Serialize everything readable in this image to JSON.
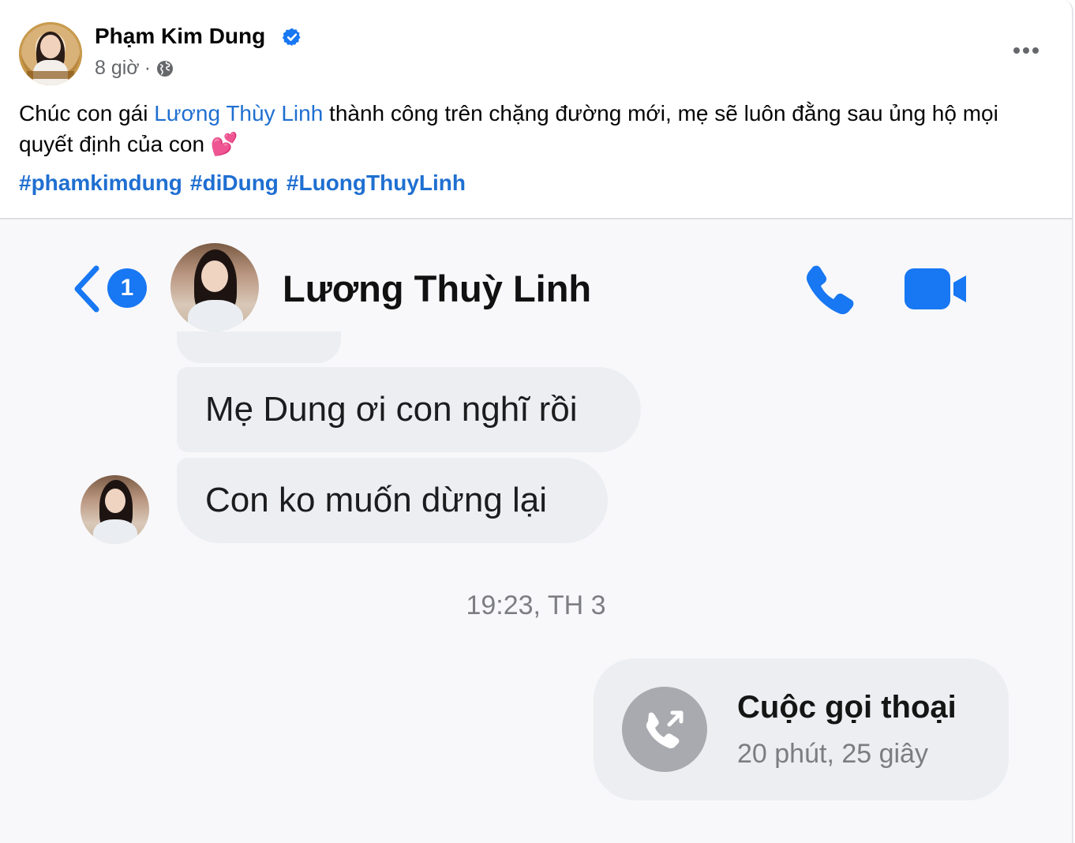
{
  "post": {
    "author": "Phạm Kim Dung",
    "time": "8 giờ",
    "separator": "·",
    "caption": {
      "before": "Chúc con gái ",
      "mention": "Lương Thùy Linh",
      "after": " thành công trên chặng đường mới, mẹ sẽ luôn đằng sau ủng hộ mọi quyết định của con 💕"
    },
    "hashtags": [
      "#phamkimdung",
      "#diDung",
      "#LuongThuyLinh"
    ]
  },
  "messenger": {
    "back_badge": "1",
    "contact_name": "Lương Thuỳ Linh",
    "messages": [
      "Mẹ Dung ơi con nghĩ rồi",
      "Con ko muốn dừng lại"
    ],
    "timestamp": "19:23, TH 3",
    "call": {
      "title": "Cuộc gọi thoại",
      "duration": "20 phút, 25 giây"
    }
  },
  "colors": {
    "link_blue": "#1f6fd1",
    "messenger_blue": "#1877f2",
    "bubble_gray": "#eceef2"
  },
  "icons": [
    "verified-badge-icon",
    "globe-icon",
    "more-options-icon",
    "back-chevron-icon",
    "phone-icon",
    "video-camera-icon",
    "outgoing-call-icon"
  ]
}
